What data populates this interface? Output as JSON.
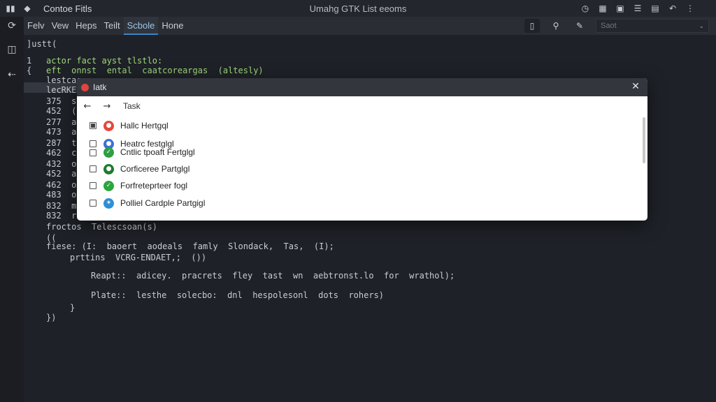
{
  "window": {
    "app_title": "Contoe Fitls",
    "title": "Umahg GTK List eeoms"
  },
  "menu": {
    "items": [
      "Felv",
      "Vew",
      "Heps",
      "Teilt",
      "Scbole",
      "Hone"
    ],
    "active_index": 4,
    "search_placeholder": "Saot"
  },
  "editor": {
    "gutter": [
      "1",
      "{"
    ],
    "lines": [
      {
        "text": "]ustt(",
        "color": "txt"
      },
      {
        "text": "actor fact ayst tlstlo:",
        "color": "kw-g"
      },
      {
        "text": "eft  onnst  ental  caatcoreargas  (altesly)",
        "color": "kw-g"
      },
      {
        "text": "lestcar",
        "color": "txt"
      },
      {
        "text": "lecRKE",
        "color": "txt"
      },
      {
        "text": "375  s",
        "color": "txt"
      },
      {
        "text": "452  (t",
        "color": "txt"
      },
      {
        "text": "277  arr",
        "color": "txt"
      },
      {
        "text": "473  ac",
        "color": "txt"
      },
      {
        "text": "287  tau",
        "color": "txt"
      },
      {
        "text": "462  con",
        "color": "txt"
      },
      {
        "text": "432  olt",
        "color": "txt"
      },
      {
        "text": "452  asa",
        "color": "txt"
      },
      {
        "text": "462  ost",
        "color": "txt"
      },
      {
        "text": "483  oart",
        "color": "txt"
      },
      {
        "text": "832  mar",
        "color": "txt"
      },
      {
        "text": "832  rea",
        "color": "txt"
      },
      {
        "text": "froctos  Telescsoan(s)",
        "color": "txt"
      },
      {
        "text": "((",
        "color": "txt"
      },
      {
        "text": "fiese: (I:  baoert  aodeals  famly  Slondack,  Tas,  (I);",
        "color": "txt"
      },
      {
        "text": "prttins  VCRG-ENDAET,;  ())",
        "color": "txt"
      },
      {
        "text": "Reapt::  adicey.  pracrets  fley  tast  wn  aebtronst.lo  for  wrathol);",
        "color": "txt"
      },
      {
        "text": "Plate::  lesthe  solecbo:  dnl  hespolesonl  dots  rohers)",
        "color": "txt"
      },
      {
        "text": "}",
        "color": "txt"
      },
      {
        "text": "})",
        "color": "txt"
      }
    ]
  },
  "dialog": {
    "title": "Iatk",
    "nav_label": "Task",
    "items": [
      {
        "label": "Hallc Hertgql",
        "checked": true,
        "icon": "chrome-icon",
        "color": "#e8453c"
      },
      {
        "label": "Heatrc festglgl",
        "checked": false,
        "icon": "blue-circle-icon",
        "color": "#3c6fd8"
      },
      {
        "label": "Cntlic tpoaft Fertglgl",
        "checked": false,
        "icon": "green-check-icon",
        "color": "#2e9e44"
      },
      {
        "label": "Corficeree Partglgl",
        "checked": false,
        "icon": "green-circle-icon",
        "color": "#1f7a2e"
      },
      {
        "label": "Forfreteprteer fogl",
        "checked": false,
        "icon": "green-check-icon",
        "color": "#2aa63c"
      },
      {
        "label": "Polliel Cardple Partgigl",
        "checked": false,
        "icon": "edge-icon",
        "color": "#2d8fd6"
      }
    ]
  }
}
